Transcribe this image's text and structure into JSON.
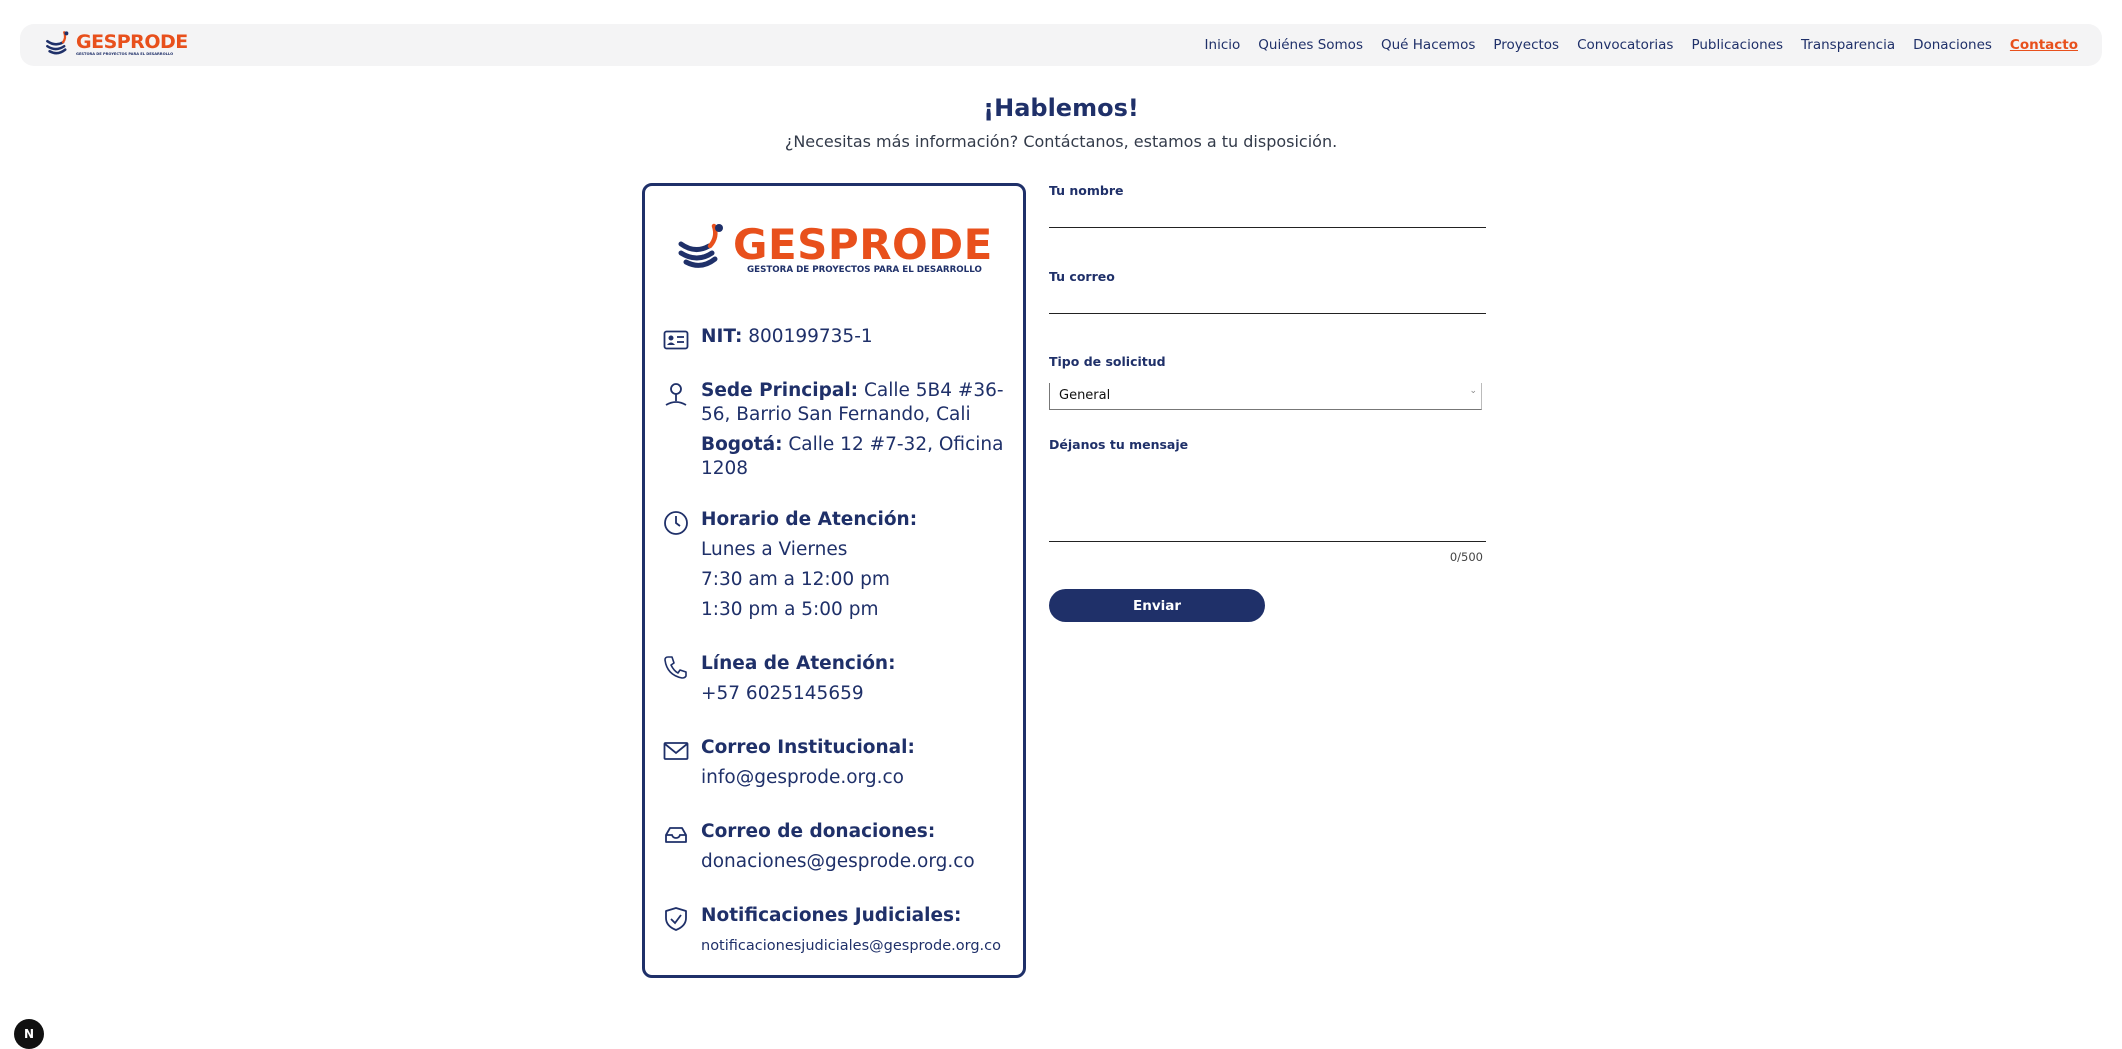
{
  "brand": {
    "name": "GESPRODE",
    "tagline": "GESTORA DE PROYECTOS PARA EL DESARROLLO",
    "accent_color": "#e8501c",
    "primary_color": "#1f3069"
  },
  "nav": {
    "items": [
      {
        "label": "Inicio",
        "active": false
      },
      {
        "label": "Quiénes Somos",
        "active": false
      },
      {
        "label": "Qué Hacemos",
        "active": false
      },
      {
        "label": "Proyectos",
        "active": false
      },
      {
        "label": "Convocatorias",
        "active": false
      },
      {
        "label": "Publicaciones",
        "active": false
      },
      {
        "label": "Transparencia",
        "active": false
      },
      {
        "label": "Donaciones",
        "active": false
      },
      {
        "label": "Contacto",
        "active": true
      }
    ]
  },
  "header": {
    "title": "¡Hablemos!",
    "subtitle": "¿Necesitas más información? Contáctanos, estamos a tu disposición."
  },
  "contact_card": {
    "nit_label": "NIT:",
    "nit_value": "800199735-1",
    "sede_label": "Sede Principal:",
    "sede_value": "Calle 5B4 #36-56, Barrio San Fernando, Cali",
    "bogota_label": "Bogotá:",
    "bogota_value": "Calle 12 #7-32, Oficina 1208",
    "horario_label": "Horario de Atención:",
    "horario_days": "Lunes a Viernes",
    "horario_morning": "7:30 am a 12:00 pm",
    "horario_afternoon": "1:30 pm a 5:00 pm",
    "linea_label": "Línea de Atención:",
    "linea_value": "+57 6025145659",
    "correo_label": "Correo Institucional:",
    "correo_value": "info@gesprode.org.co",
    "donaciones_label": "Correo de donaciones:",
    "donaciones_value": "donaciones@gesprode.org.co",
    "judiciales_label": "Notificaciones Judiciales:",
    "judiciales_value": "notificacionesjudiciales@gesprode.org.co"
  },
  "form": {
    "name_label": "Tu nombre",
    "name_value": "",
    "email_label": "Tu correo",
    "email_value": "",
    "type_label": "Tipo de solicitud",
    "type_value": "General",
    "message_label": "Déjanos tu mensaje",
    "message_value": "",
    "counter": "0/500",
    "submit_label": "Enviar"
  },
  "dev_badge": "N"
}
